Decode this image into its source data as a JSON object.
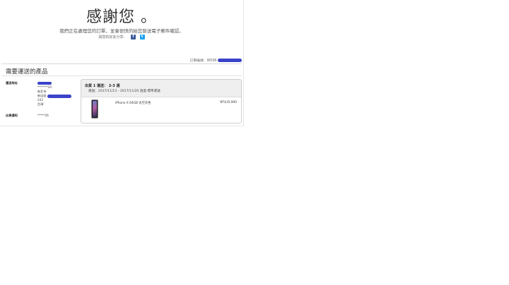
{
  "header": {
    "thanks": "感謝您 。",
    "processing": "我們正在處理您的訂單，並會很快的給您發送電子郵件確認。",
    "share_label": "與您的好友分享：",
    "social": [
      "facebook-icon",
      "twitter-icon"
    ],
    "facebook_glyph": "f",
    "twitter_glyph": "t"
  },
  "order": {
    "label": "訂單編號：W506"
  },
  "section": {
    "title": "需要運送的產品"
  },
  "address": {
    "label": "運送地址",
    "line1": "*******20",
    "line2": "新北市",
    "line3_prefix": "新店區",
    "line4": "242",
    "line5": "台灣"
  },
  "contact": {
    "label": "出貨通知",
    "value": "*****26"
  },
  "shipment": {
    "title": "出貨 1 運送： 2-3 週",
    "dates": "運送：2017/11/13 - 2017/11/20 透過 標準運送",
    "product": "iPhone X 64GB 太空灰色",
    "price": "NT$35,900"
  },
  "colors": {
    "redaction": "#3b43c9",
    "facebook": "#3b5998",
    "twitter": "#1da1f2"
  }
}
